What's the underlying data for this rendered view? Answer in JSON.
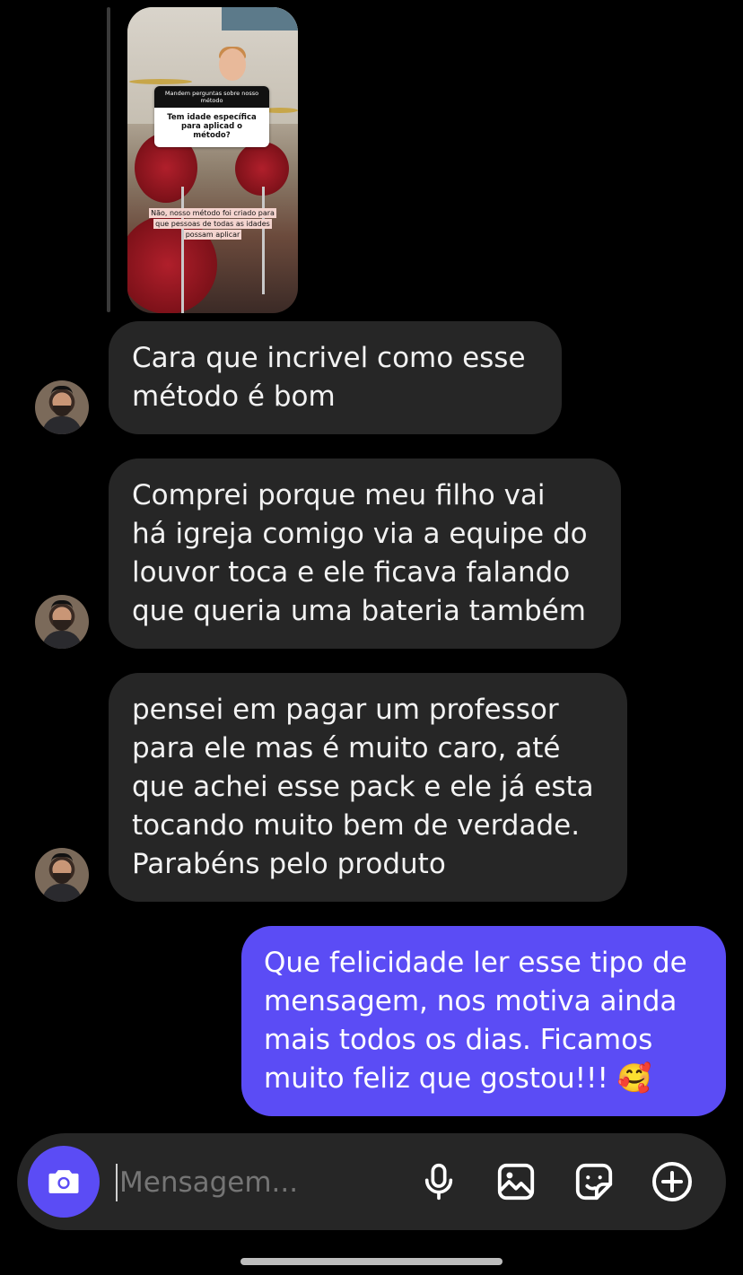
{
  "story_reply": {
    "question_header": "Mandem perguntas sobre nosso método",
    "question": "Tem idade específica para aplicad o método?",
    "answer": "Não, nosso método foi criado para que pessoas de todas as idades possam aplicar"
  },
  "messages": [
    {
      "direction": "incoming",
      "text": "Cara que incrivel como esse\nmétodo é bom"
    },
    {
      "direction": "incoming",
      "text": "Comprei porque meu filho vai\nhá igreja comigo via a equipe do\nlouvor toca e ele ficava falando\nque queria uma bateria também"
    },
    {
      "direction": "incoming",
      "text": "pensei em pagar um professor\npara ele mas é muito caro, até\nque achei esse pack e ele já esta\ntocando muito bem de verdade.\nParabéns pelo produto"
    },
    {
      "direction": "outgoing",
      "text": "Que felicidade ler esse tipo de\nmensagem, nos motiva ainda\nmais todos os dias. Ficamos\nmuito feliz que gostou!!! 🥰"
    }
  ],
  "composer": {
    "placeholder": "Mensagem...",
    "icons": [
      "camera-icon",
      "microphone-icon",
      "gallery-icon",
      "sticker-icon",
      "add-icon"
    ]
  },
  "colors": {
    "background": "#000000",
    "incoming_bubble": "#262626",
    "outgoing_bubble": "#5b4cf5",
    "accent": "#5b4cf5"
  }
}
